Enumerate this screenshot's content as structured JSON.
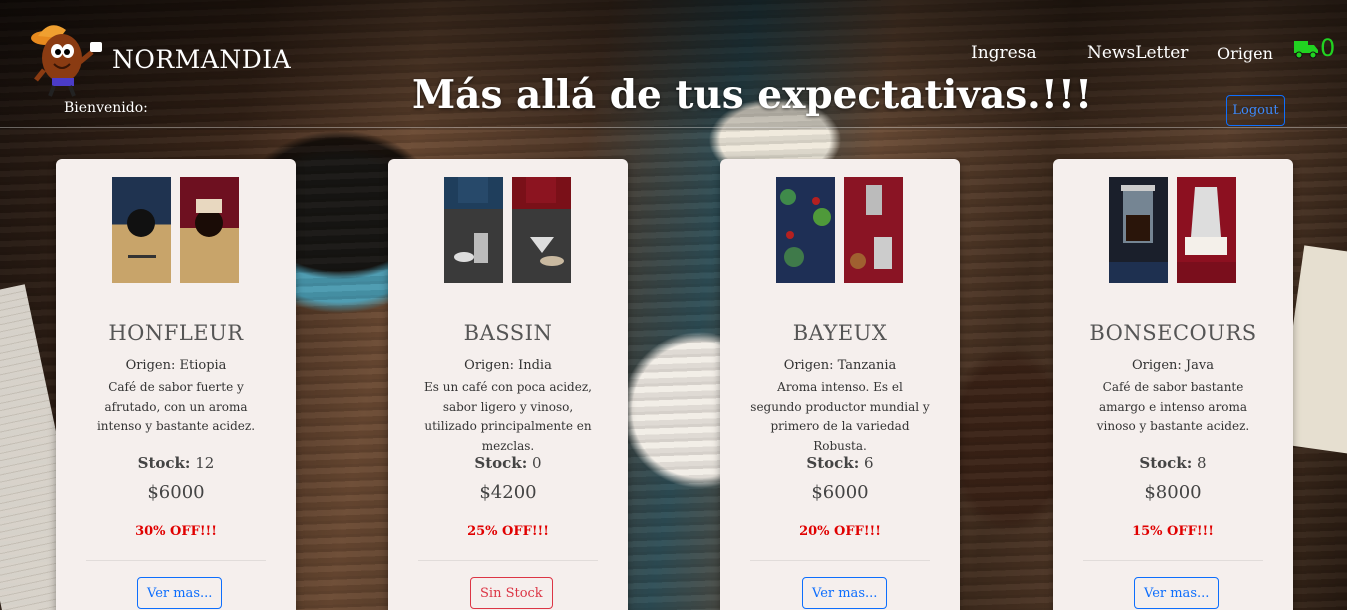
{
  "brand": {
    "name": "NORMANDIA"
  },
  "header": {
    "welcome": "Bienvenido:",
    "title": "Más allá de tus expectativas.!!!"
  },
  "nav": {
    "items": [
      {
        "label": "Ingresa"
      },
      {
        "label": "NewsLetter"
      },
      {
        "label": "Origen"
      }
    ],
    "cart_count": "0",
    "logout_label": "Logout"
  },
  "colors": {
    "cart": "#21d321",
    "discount": "#e00000",
    "primary_button": "#0d6efd",
    "danger_button": "#dc3545"
  },
  "products": [
    {
      "name": "HONFLEUR",
      "origin": "Origen: Etiopia",
      "description": "Café de sabor fuerte y afrutado, con un aroma intenso y bastante acidez.",
      "stock_label": "Stock:",
      "stock_value": "12",
      "price": "$6000",
      "discount": "30% OFF!!!",
      "button_label": "Ver mas...",
      "button_style": "primary"
    },
    {
      "name": "BASSIN",
      "origin": "Origen: India",
      "description": "Es un café con poca acidez, sabor ligero y vinoso, utilizado principalmente en mezclas.",
      "stock_label": "Stock:",
      "stock_value": "0",
      "price": "$4200",
      "discount": "25% OFF!!!",
      "button_label": "Sin Stock",
      "button_style": "danger"
    },
    {
      "name": "BAYEUX",
      "origin": "Origen: Tanzania",
      "description": "Aroma intenso. Es el segundo productor mundial y primero de la variedad Robusta.",
      "stock_label": "Stock:",
      "stock_value": "6",
      "price": "$6000",
      "discount": "20% OFF!!!",
      "button_label": "Ver mas...",
      "button_style": "primary"
    },
    {
      "name": "BONSECOURS",
      "origin": "Origen: Java",
      "description": "Café de sabor bastante amargo e intenso aroma vinoso y bastante acidez.",
      "stock_label": "Stock:",
      "stock_value": "8",
      "price": "$8000",
      "discount": "15% OFF!!!",
      "button_label": "Ver mas...",
      "button_style": "primary"
    }
  ]
}
